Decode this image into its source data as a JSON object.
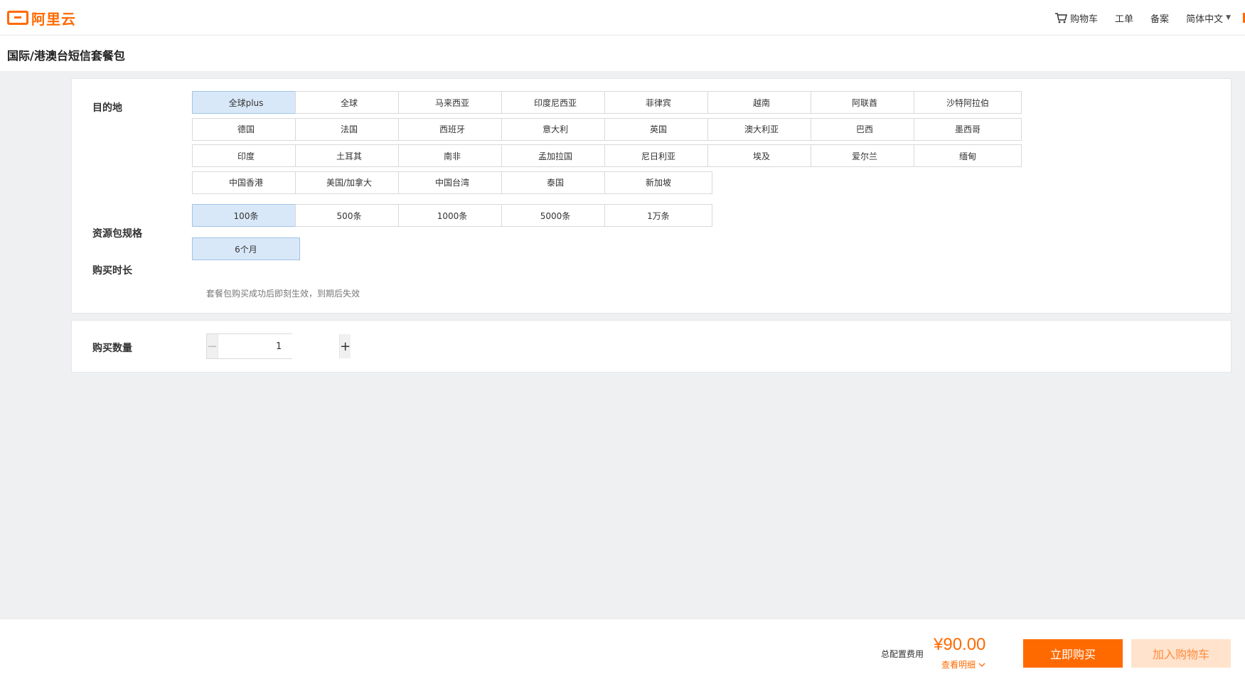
{
  "header": {
    "logo_text": "阿里云",
    "nav": {
      "cart": "购物车",
      "ticket": "工单",
      "filing": "备案",
      "language": "简体中文"
    }
  },
  "page": {
    "title": "国际/港澳台短信套餐包"
  },
  "destination": {
    "label": "目的地",
    "options": [
      "全球plus",
      "全球",
      "马来西亚",
      "印度尼西亚",
      "菲律宾",
      "越南",
      "阿联酋",
      "沙特阿拉伯",
      "德国",
      "法国",
      "西班牙",
      "意大利",
      "英国",
      "澳大利亚",
      "巴西",
      "墨西哥",
      "印度",
      "土耳其",
      "南非",
      "孟加拉国",
      "尼日利亚",
      "埃及",
      "爱尔兰",
      "缅甸",
      "中国香港",
      "美国/加拿大",
      "中国台湾",
      "泰国",
      "新加坡"
    ],
    "selected": "全球plus"
  },
  "package_spec": {
    "label": "资源包规格",
    "options": [
      "100条",
      "500条",
      "1000条",
      "5000条",
      "1万条"
    ],
    "selected": "100条"
  },
  "duration": {
    "label": "购买时长",
    "options": [
      "6个月"
    ],
    "selected": "6个月",
    "note": "套餐包购买成功后即刻生效，到期后失效"
  },
  "quantity": {
    "label": "购买数量",
    "value": "1",
    "minus": "−",
    "plus": "+"
  },
  "footer": {
    "fee_label": "总配置费用",
    "price": "¥90.00",
    "detail_link": "查看明细",
    "buy_now": "立即购买",
    "add_to_cart": "加入购物车"
  },
  "colors": {
    "accent": "#ff6a00",
    "selected_bg": "#d9e8f8",
    "page_bg": "#eff0f2"
  }
}
